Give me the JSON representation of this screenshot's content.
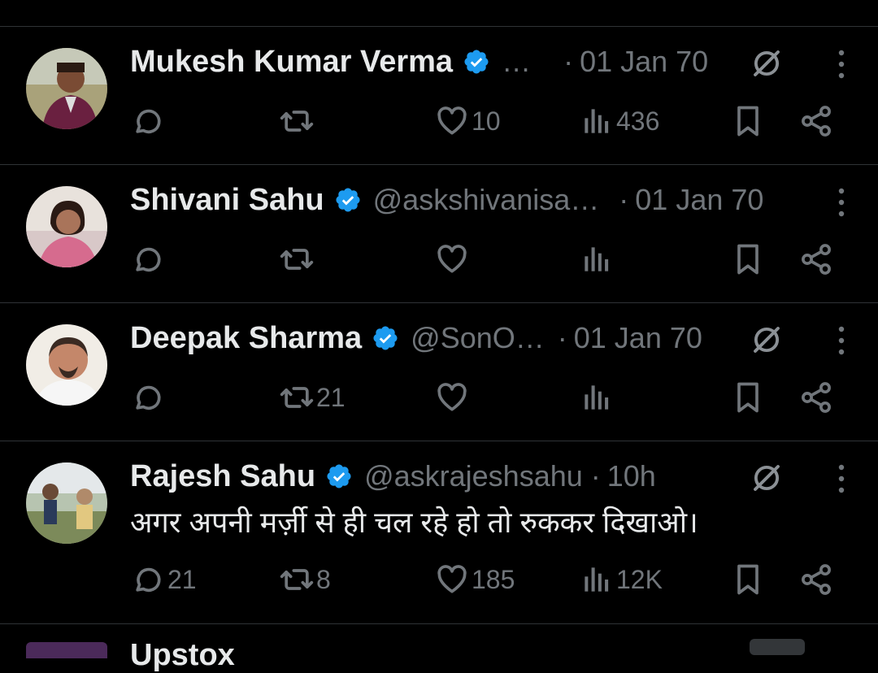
{
  "colors": {
    "background": "#000000",
    "text": "#e7e9ea",
    "muted": "#71767b",
    "divider": "#2f3336",
    "verified": "#1d9bf0"
  },
  "posts": [
    {
      "name": "Mukesh Kumar Verma",
      "handle": "…",
      "dot": "·",
      "time": "01 Jan 70",
      "content": "",
      "has_grok": true,
      "stats": {
        "replies": "",
        "reposts": "",
        "likes": "10",
        "views": "436"
      }
    },
    {
      "name": "Shivani Sahu",
      "handle": "@askshivanisa…",
      "dot": "·",
      "time": "01 Jan 70",
      "content": "",
      "has_grok": false,
      "stats": {
        "replies": "",
        "reposts": "",
        "likes": "",
        "views": ""
      }
    },
    {
      "name": "Deepak Sharma",
      "handle": "@SonO…",
      "dot": "·",
      "time": "01 Jan 70",
      "content": "",
      "has_grok": true,
      "stats": {
        "replies": "",
        "reposts": "21",
        "likes": "",
        "views": ""
      }
    },
    {
      "name": "Rajesh Sahu",
      "handle": "@askrajeshsahu",
      "dot": "·",
      "time": "10h",
      "content": "अगर अपनी मर्ज़ी से ही चल रहे हो तो रुककर दिखाओ।",
      "has_grok": true,
      "stats": {
        "replies": "21",
        "reposts": "8",
        "likes": "185",
        "views": "12K"
      }
    }
  ],
  "next_post": {
    "name": "Upstox"
  },
  "icons": {
    "verified": "verified-badge-icon",
    "grok": "grok-icon",
    "more": "more-options-icon",
    "reply": "reply-icon",
    "repost": "repost-icon",
    "like": "like-icon",
    "views": "views-icon",
    "bookmark": "bookmark-icon",
    "share": "share-icon"
  }
}
